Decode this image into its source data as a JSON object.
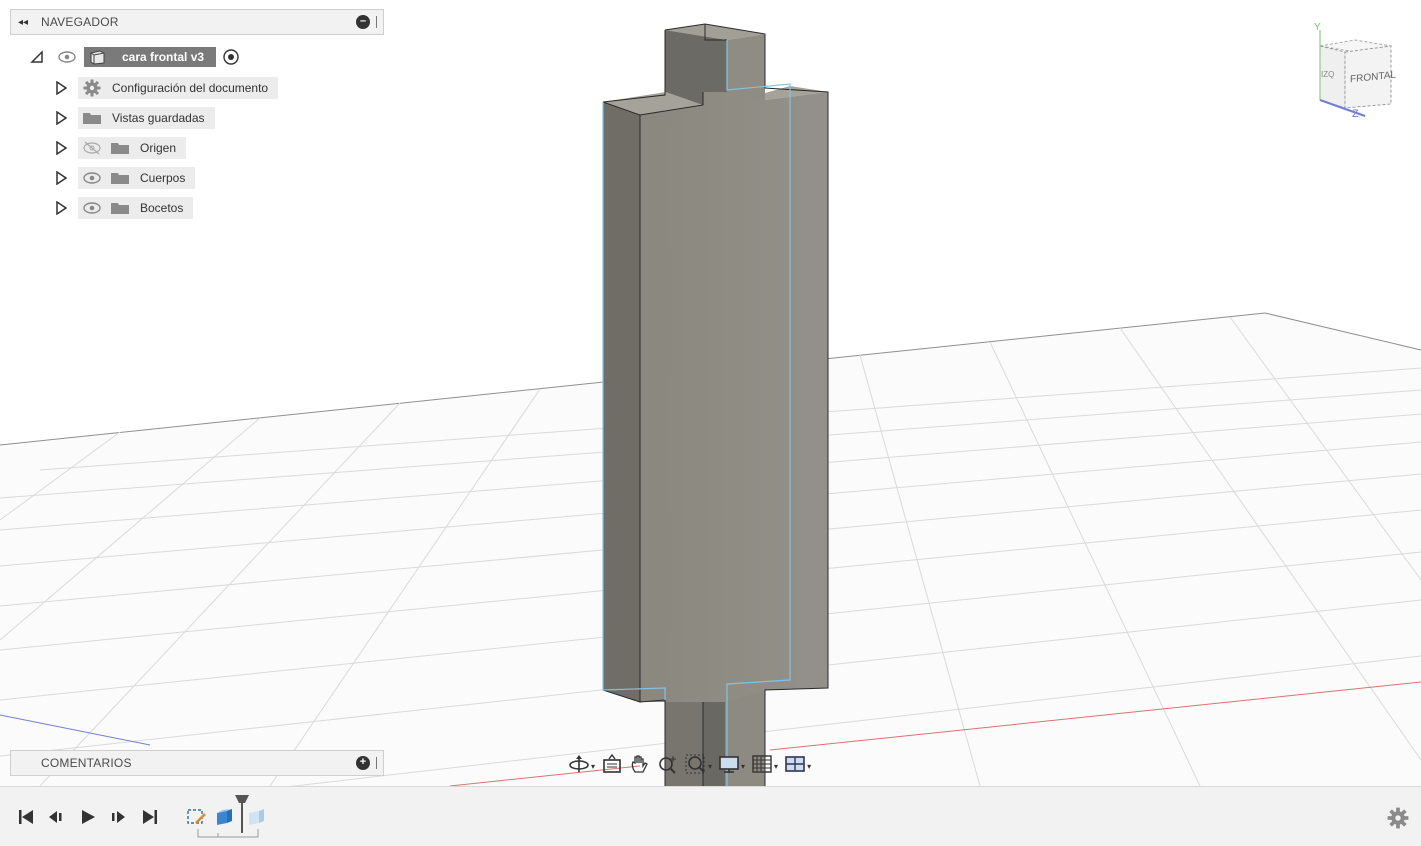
{
  "navigator": {
    "title": "NAVEGADOR",
    "root": {
      "label": "cara frontal v3"
    },
    "items": [
      {
        "label": "Configuración del documento",
        "icon": "gear-icon",
        "visible_toggle": false
      },
      {
        "label": "Vistas guardadas",
        "icon": "folder-icon",
        "visible_toggle": false
      },
      {
        "label": "Origen",
        "icon": "folder-icon",
        "visibility": "hidden"
      },
      {
        "label": "Cuerpos",
        "icon": "folder-icon",
        "visibility": "visible"
      },
      {
        "label": "Bocetos",
        "icon": "folder-icon",
        "visibility": "visible"
      }
    ]
  },
  "comments": {
    "title": "COMENTARIOS"
  },
  "viewcube": {
    "face_label": "FRONTAL",
    "side_label": "IZQ",
    "axis_y": "Y",
    "axis_z": "Z"
  },
  "toolbar": {
    "tools": [
      "orbit-icon",
      "look-at-icon",
      "pan-icon",
      "zoom-icon",
      "fit-icon",
      "display-settings-icon",
      "grid-icon",
      "viewports-icon"
    ]
  },
  "timeline": {
    "controls": [
      "go-to-start-icon",
      "step-back-icon",
      "play-icon",
      "step-forward-icon",
      "go-to-end-icon"
    ]
  },
  "colors": {
    "panel_bg": "#f2f2f2",
    "body_face": "#8d8a80",
    "body_side": "#6e6c65",
    "body_top": "#a19e95",
    "edge_highlight": "#7fc4e4",
    "grid_line": "#d4d4d4",
    "axis_red": "#e07070",
    "axis_blue": "#6f7fd8"
  }
}
